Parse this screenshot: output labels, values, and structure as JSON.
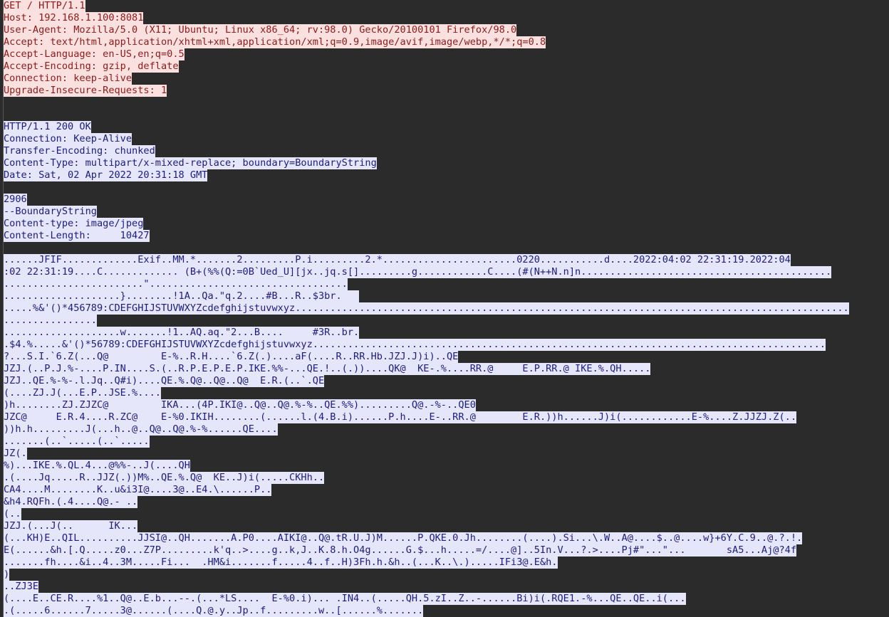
{
  "request": [
    "GET / HTTP/1.1",
    "Host: 192.168.1.100:8081",
    "User-Agent: Mozilla/5.0 (X11; Ubuntu; Linux x86_64; rv:98.0) Gecko/20100101 Firefox/98.0",
    "Accept: text/html,application/xhtml+xml,application/xml;q=0.9,image/avif,image/webp,*/*;q=0.8",
    "Accept-Language: en-US,en;q=0.5",
    "Accept-Encoding: gzip, deflate",
    "Connection: keep-alive",
    "Upgrade-Insecure-Requests: 1"
  ],
  "response_headers": [
    "HTTP/1.1 200 OK",
    "Connection: Keep-Alive",
    "Transfer-Encoding: chunked",
    "Content-Type: multipart/x-mixed-replace; boundary=BoundaryString",
    "Date: Sat, 02 Apr 2022 20:31:18 GMT"
  ],
  "chunk_header": [
    "2906",
    "--BoundaryString",
    "Content-type: image/jpeg",
    "Content-Length:     10427"
  ],
  "payload": [
    "......JFIF.............Exif..MM.*.......2.........P.i.........2.*.......................0220...........d....2022:04:02 22:31:19.2022:04",
    ":02 22:31:19....C............. (B+(%%(Q:=0B`Ued_U][jx..jq.s[].........g............C....(#(N++N.n]n...........................................",
    "........................\"..................................",
    "....................}........!1A..Qa.\"q.2....#B...R..$3br.   ",
    ".....%&'()*456789:CDEFGHIJSTUVWXYZcdefghijstuvwxyz...............................................................................................",
    "................",
    "....................w.......!1..AQ.aq.\"2...B....     #3R..br.",
    ".$4.%.....&'()*56789:CDEFGHIJSTUVWXYZcdefghijstuvwxyz........................................................................................",
    "?...S.I.`6.Z(...Q@         E-%..R.H....`6.Z(.)....aF(....R..RR.Hb.JZJ.J)i)..QE",
    "JZJ.(..P.J.%-....P.IN....S.(..R.P.E.P.E.P.IKE.%%-...QE.!..(.))....QK@  KE-.%....RR.@     E.P.RR.@ IKE.%.QH.....",
    "JZJ..QE.%-%-.l.Jq..Q#i)....QE.%.Q@..Q@..Q@  E.R.(..`.QE",
    "(....ZJ.J(...E.P..JSE.%....",
    ")h........ZJ.ZJZC@         IKA...(4P.IKI@..Q@..Q@.%-%..QE.%%).........Q@.-%-..QE0",
    "JZC@     E.R.4....R.ZC@    E-%0.IKIH........(......l.(4.B.i)......P.h....E-..RR.@        E.R.))h......J)i(............E-%....Z.JJZJ.Z(..",
    "))h.h.........J(...h..@..Q@..Q@.%-%......QE....",
    ".......(..`.....(..`.....",
    "JZ(.",
    "%)...IKE.%.QL.4...@%%-..J(....QH",
    ".(....Jq.....R..JJZ(.))M%..QE.%.Q@  KE..J)i(.....CKHh..",
    "CA4....M........K..u&i3I@....3@..E4.\\......P..",
    "&h4.RQFh.(.4....Q@.- ..",
    "(..",
    "JZJ.(...J(..      IK...",
    "(...KH)E..QIL..........JJSI@..QH.......A.P0....AIKI@..Q@.tR.U.J)M......P.QKE.0.Jh........(....).Si...\\.W..A@....$..@....w}+6Y.C.9..@.?.!.",
    "E(......&h.[.Q.....z0...Z7P.........k'q..>....g..k,J..K.8.h.O4g......G.$...h.....=/....@]..5In.V...?.>....Pj#\"...\"...       sA5...Aj@?4f",
    ".......fh....&i..4..3M.....Fi...  .HM&i.......f.....4..f..H)3Fh.h.&h..(...K..\\.).....IFi3@.E&h.",
    ")",
    "..ZJ3E",
    "(....E..CE.R....%1..Q@..E.b...--.(...*LS....  E-%0.i)... .IN4..(.....QH.5.zI..Z..-......Bi)i(.RQE1.-%...QE..QE..i(...",
    ".(.....6......7.....3@......(....Q.@.y..Jp..f.........w..[......%......."
  ]
}
